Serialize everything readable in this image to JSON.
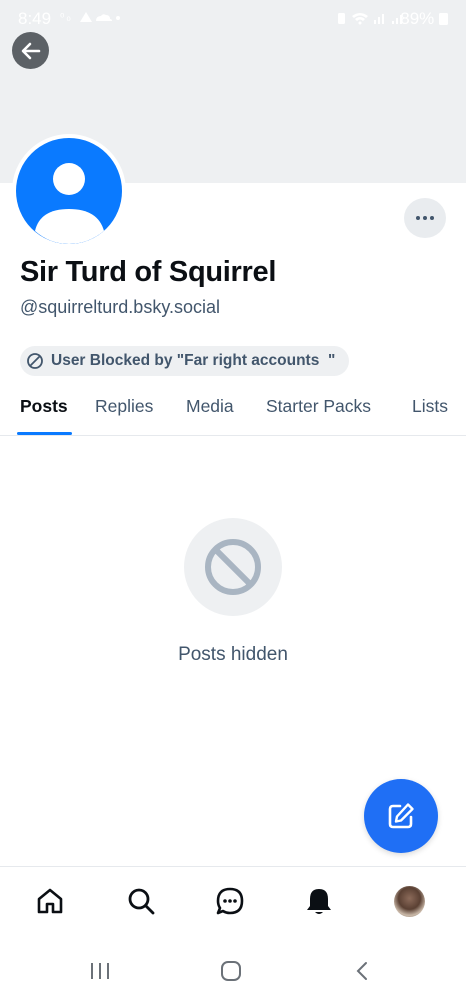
{
  "status_bar": {
    "time": "8:49",
    "battery": "89%",
    "left_icons": [
      "notification-icons"
    ],
    "right_icons": [
      "wifi",
      "signal",
      "battery"
    ]
  },
  "profile": {
    "display_name": "Sir Turd of Squirrel",
    "handle": "@squirrelturd.bsky.social",
    "blocked_label": "User Blocked by \"Far right accounts  \""
  },
  "tabs": [
    {
      "label": "Posts",
      "active": true
    },
    {
      "label": "Replies",
      "active": false
    },
    {
      "label": "Media",
      "active": false
    },
    {
      "label": "Starter Packs",
      "active": false
    },
    {
      "label": "Lists",
      "active": false
    }
  ],
  "empty_state": {
    "text": "Posts hidden",
    "icon": "blocked-icon"
  },
  "bottom_nav": [
    "home-icon",
    "search-icon",
    "chat-icon",
    "bell-icon",
    "profile-avatar"
  ],
  "colors": {
    "accent": "#0a7aff",
    "fab": "#1f6ff5",
    "muted_text": "#42566c",
    "banner": "#eef0f2"
  }
}
